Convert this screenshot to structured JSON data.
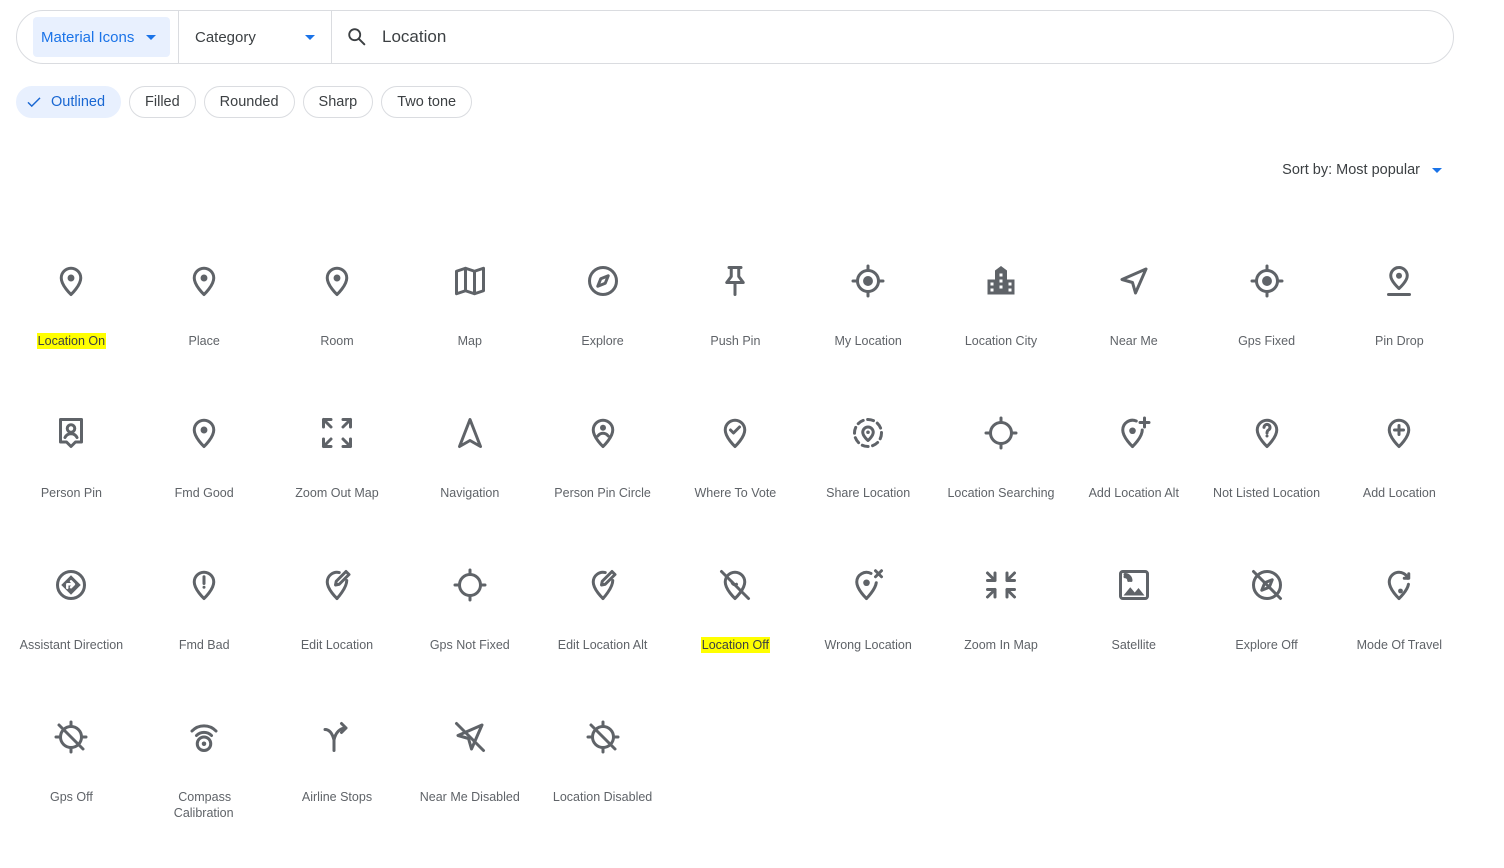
{
  "search": {
    "icon_set": "Material Icons",
    "category": "Category",
    "query": "Location"
  },
  "styles": [
    "Outlined",
    "Filled",
    "Rounded",
    "Sharp",
    "Two tone"
  ],
  "selected_style": "Outlined",
  "sort": {
    "label": "Sort by: Most popular"
  },
  "colors": {
    "accent": "#1a73e8",
    "chip_selected_bg": "#e8f0fe",
    "icon": "#5f6368",
    "highlight": "#ffff00"
  },
  "icons": [
    {
      "label": "Location On",
      "icon": "pin",
      "highlighted": true
    },
    {
      "label": "Place",
      "icon": "pin"
    },
    {
      "label": "Room",
      "icon": "pin"
    },
    {
      "label": "Map",
      "icon": "map"
    },
    {
      "label": "Explore",
      "icon": "compass"
    },
    {
      "label": "Push Pin",
      "icon": "pushpin"
    },
    {
      "label": "My Location",
      "icon": "target"
    },
    {
      "label": "Location City",
      "icon": "city"
    },
    {
      "label": "Near Me",
      "icon": "arrow"
    },
    {
      "label": "Gps Fixed",
      "icon": "target"
    },
    {
      "label": "Pin Drop",
      "icon": "pindrop"
    },
    {
      "label": "Person Pin",
      "icon": "personpin"
    },
    {
      "label": "Fmd Good",
      "icon": "pin"
    },
    {
      "label": "Zoom Out Map",
      "icon": "zoomout"
    },
    {
      "label": "Navigation",
      "icon": "navigation"
    },
    {
      "label": "Person Pin Circle",
      "icon": "personpincircle"
    },
    {
      "label": "Where To Vote",
      "icon": "pincheck"
    },
    {
      "label": "Share Location",
      "icon": "sharelocation"
    },
    {
      "label": "Location Searching",
      "icon": "searching"
    },
    {
      "label": "Add Location Alt",
      "icon": "addlocationalt"
    },
    {
      "label": "Not Listed Location",
      "icon": "pinquestion"
    },
    {
      "label": "Add Location",
      "icon": "pinplus"
    },
    {
      "label": "Assistant Direction",
      "icon": "direction"
    },
    {
      "label": "Fmd Bad",
      "icon": "pinexclaim"
    },
    {
      "label": "Edit Location",
      "icon": "pinedit"
    },
    {
      "label": "Gps Not Fixed",
      "icon": "searching"
    },
    {
      "label": "Edit Location Alt",
      "icon": "pinedit"
    },
    {
      "label": "Location Off",
      "icon": "pinoff",
      "highlighted": true
    },
    {
      "label": "Wrong Location",
      "icon": "pinx"
    },
    {
      "label": "Zoom In Map",
      "icon": "zoomin"
    },
    {
      "label": "Satellite",
      "icon": "satellite"
    },
    {
      "label": "Explore Off",
      "icon": "compassoff"
    },
    {
      "label": "Mode Of Travel",
      "icon": "travel"
    },
    {
      "label": "Gps Off",
      "icon": "gpsoff"
    },
    {
      "label": "Compass Calibration",
      "icon": "calibration"
    },
    {
      "label": "Airline Stops",
      "icon": "airline"
    },
    {
      "label": "Near Me Disabled",
      "icon": "arrowoff"
    },
    {
      "label": "Location Disabled",
      "icon": "gpsoff"
    }
  ]
}
